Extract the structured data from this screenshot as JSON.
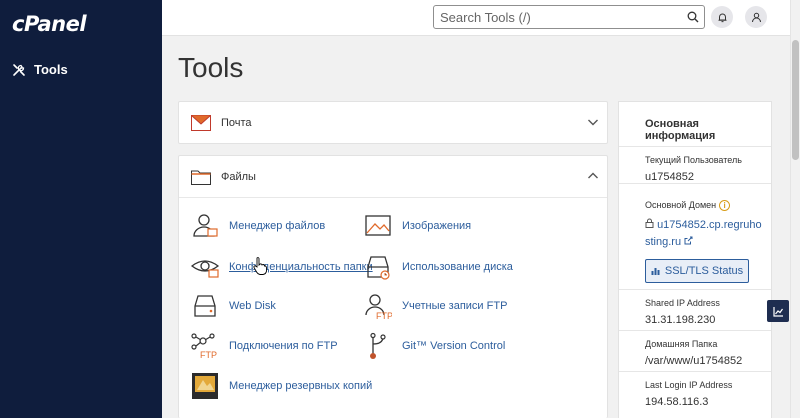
{
  "brand": {
    "logo_text": "cPanel"
  },
  "sidebar": {
    "items": [
      {
        "label": "Tools",
        "icon": "tools-icon"
      }
    ]
  },
  "topbar": {
    "search_placeholder": "Search Tools (/)"
  },
  "page": {
    "title": "Tools"
  },
  "panels": {
    "mail": {
      "title": "Почта",
      "state": "collapsed"
    },
    "files": {
      "title": "Файлы",
      "state": "expanded",
      "tools": [
        {
          "label": "Менеджер файлов",
          "icon": "file-manager-icon"
        },
        {
          "label": "Изображения",
          "icon": "images-icon"
        },
        {
          "label": "Конфиденциальность папки",
          "icon": "directory-privacy-icon"
        },
        {
          "label": "Использование диска",
          "icon": "disk-usage-icon"
        },
        {
          "label": "Web Disk",
          "icon": "web-disk-icon"
        },
        {
          "label": "Учетные записи FTP",
          "icon": "ftp-accounts-icon"
        },
        {
          "label": "Подключения по FTP",
          "icon": "ftp-connections-icon"
        },
        {
          "label": "Git™ Version Control",
          "icon": "git-icon"
        },
        {
          "label": "Менеджер резервных копий",
          "icon": "backup-icon"
        }
      ],
      "ftp_tag": "FTP"
    }
  },
  "info": {
    "title": "Основная информация",
    "current_user_label": "Текущий Пользователь",
    "current_user": "u1754852",
    "domain_label": "Основной Домен",
    "domain_line1": "u1754852.cp.regruho",
    "domain_line2": "sting.ru",
    "ssl_button": "SSL/TLS Status",
    "shared_ip_label": "Shared IP Address",
    "shared_ip": "31.31.198.230",
    "home_label": "Домашняя Папка",
    "home": "/var/www/u1754852",
    "last_login_label": "Last Login IP Address",
    "last_login": "194.58.116.3",
    "info_badge": "i"
  },
  "colors": {
    "sidebar": "#0f1d3d",
    "link": "#2c5d9c",
    "accent_orange": "#e06a2b"
  }
}
